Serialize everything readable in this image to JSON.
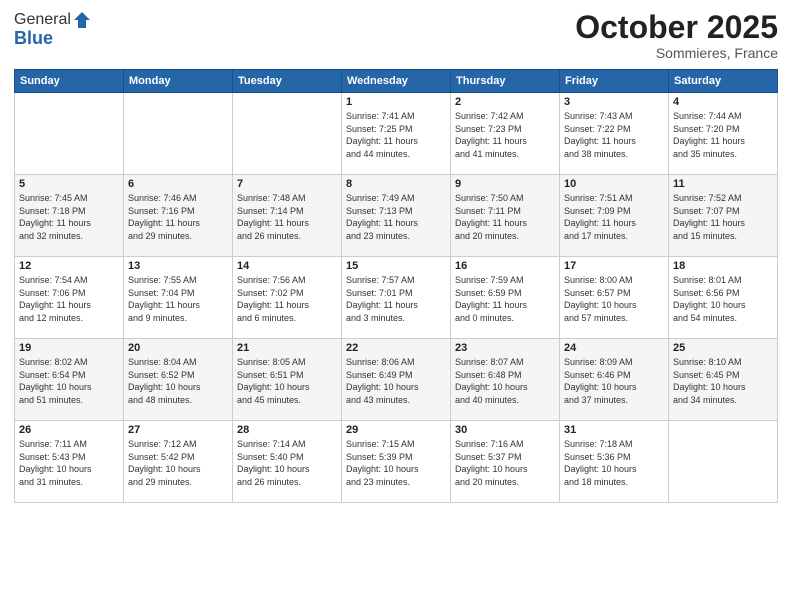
{
  "header": {
    "logo_general": "General",
    "logo_blue": "Blue",
    "month": "October 2025",
    "location": "Sommieres, France"
  },
  "weekdays": [
    "Sunday",
    "Monday",
    "Tuesday",
    "Wednesday",
    "Thursday",
    "Friday",
    "Saturday"
  ],
  "weeks": [
    [
      {
        "day": "",
        "info": ""
      },
      {
        "day": "",
        "info": ""
      },
      {
        "day": "",
        "info": ""
      },
      {
        "day": "1",
        "info": "Sunrise: 7:41 AM\nSunset: 7:25 PM\nDaylight: 11 hours\nand 44 minutes."
      },
      {
        "day": "2",
        "info": "Sunrise: 7:42 AM\nSunset: 7:23 PM\nDaylight: 11 hours\nand 41 minutes."
      },
      {
        "day": "3",
        "info": "Sunrise: 7:43 AM\nSunset: 7:22 PM\nDaylight: 11 hours\nand 38 minutes."
      },
      {
        "day": "4",
        "info": "Sunrise: 7:44 AM\nSunset: 7:20 PM\nDaylight: 11 hours\nand 35 minutes."
      }
    ],
    [
      {
        "day": "5",
        "info": "Sunrise: 7:45 AM\nSunset: 7:18 PM\nDaylight: 11 hours\nand 32 minutes."
      },
      {
        "day": "6",
        "info": "Sunrise: 7:46 AM\nSunset: 7:16 PM\nDaylight: 11 hours\nand 29 minutes."
      },
      {
        "day": "7",
        "info": "Sunrise: 7:48 AM\nSunset: 7:14 PM\nDaylight: 11 hours\nand 26 minutes."
      },
      {
        "day": "8",
        "info": "Sunrise: 7:49 AM\nSunset: 7:13 PM\nDaylight: 11 hours\nand 23 minutes."
      },
      {
        "day": "9",
        "info": "Sunrise: 7:50 AM\nSunset: 7:11 PM\nDaylight: 11 hours\nand 20 minutes."
      },
      {
        "day": "10",
        "info": "Sunrise: 7:51 AM\nSunset: 7:09 PM\nDaylight: 11 hours\nand 17 minutes."
      },
      {
        "day": "11",
        "info": "Sunrise: 7:52 AM\nSunset: 7:07 PM\nDaylight: 11 hours\nand 15 minutes."
      }
    ],
    [
      {
        "day": "12",
        "info": "Sunrise: 7:54 AM\nSunset: 7:06 PM\nDaylight: 11 hours\nand 12 minutes."
      },
      {
        "day": "13",
        "info": "Sunrise: 7:55 AM\nSunset: 7:04 PM\nDaylight: 11 hours\nand 9 minutes."
      },
      {
        "day": "14",
        "info": "Sunrise: 7:56 AM\nSunset: 7:02 PM\nDaylight: 11 hours\nand 6 minutes."
      },
      {
        "day": "15",
        "info": "Sunrise: 7:57 AM\nSunset: 7:01 PM\nDaylight: 11 hours\nand 3 minutes."
      },
      {
        "day": "16",
        "info": "Sunrise: 7:59 AM\nSunset: 6:59 PM\nDaylight: 11 hours\nand 0 minutes."
      },
      {
        "day": "17",
        "info": "Sunrise: 8:00 AM\nSunset: 6:57 PM\nDaylight: 10 hours\nand 57 minutes."
      },
      {
        "day": "18",
        "info": "Sunrise: 8:01 AM\nSunset: 6:56 PM\nDaylight: 10 hours\nand 54 minutes."
      }
    ],
    [
      {
        "day": "19",
        "info": "Sunrise: 8:02 AM\nSunset: 6:54 PM\nDaylight: 10 hours\nand 51 minutes."
      },
      {
        "day": "20",
        "info": "Sunrise: 8:04 AM\nSunset: 6:52 PM\nDaylight: 10 hours\nand 48 minutes."
      },
      {
        "day": "21",
        "info": "Sunrise: 8:05 AM\nSunset: 6:51 PM\nDaylight: 10 hours\nand 45 minutes."
      },
      {
        "day": "22",
        "info": "Sunrise: 8:06 AM\nSunset: 6:49 PM\nDaylight: 10 hours\nand 43 minutes."
      },
      {
        "day": "23",
        "info": "Sunrise: 8:07 AM\nSunset: 6:48 PM\nDaylight: 10 hours\nand 40 minutes."
      },
      {
        "day": "24",
        "info": "Sunrise: 8:09 AM\nSunset: 6:46 PM\nDaylight: 10 hours\nand 37 minutes."
      },
      {
        "day": "25",
        "info": "Sunrise: 8:10 AM\nSunset: 6:45 PM\nDaylight: 10 hours\nand 34 minutes."
      }
    ],
    [
      {
        "day": "26",
        "info": "Sunrise: 7:11 AM\nSunset: 5:43 PM\nDaylight: 10 hours\nand 31 minutes."
      },
      {
        "day": "27",
        "info": "Sunrise: 7:12 AM\nSunset: 5:42 PM\nDaylight: 10 hours\nand 29 minutes."
      },
      {
        "day": "28",
        "info": "Sunrise: 7:14 AM\nSunset: 5:40 PM\nDaylight: 10 hours\nand 26 minutes."
      },
      {
        "day": "29",
        "info": "Sunrise: 7:15 AM\nSunset: 5:39 PM\nDaylight: 10 hours\nand 23 minutes."
      },
      {
        "day": "30",
        "info": "Sunrise: 7:16 AM\nSunset: 5:37 PM\nDaylight: 10 hours\nand 20 minutes."
      },
      {
        "day": "31",
        "info": "Sunrise: 7:18 AM\nSunset: 5:36 PM\nDaylight: 10 hours\nand 18 minutes."
      },
      {
        "day": "",
        "info": ""
      }
    ]
  ]
}
